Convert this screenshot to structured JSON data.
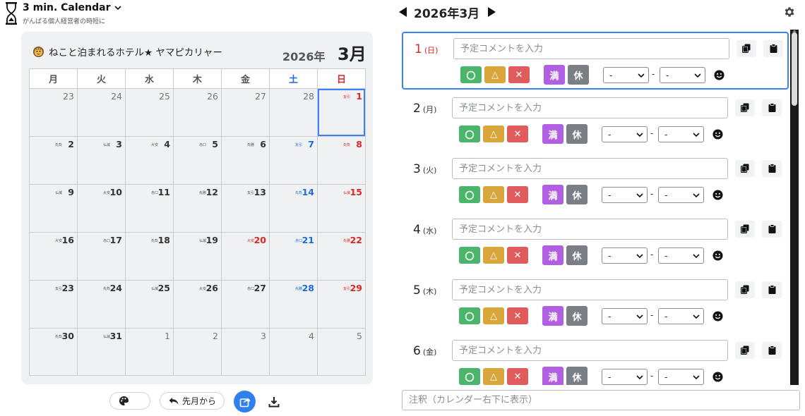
{
  "app": {
    "title": "3 min. Calendar",
    "subtitle": "がんばる個人経営者の時短に"
  },
  "calendar": {
    "hotel_name": "ねこと泊まれるホテル★ ヤマピカリャー",
    "year_label": "2026年",
    "month_label": "3月",
    "weekdays": [
      "月",
      "火",
      "水",
      "木",
      "金",
      "土",
      "日"
    ],
    "weeks": [
      [
        {
          "d": "23",
          "rk": "",
          "out": true
        },
        {
          "d": "24",
          "rk": "",
          "out": true
        },
        {
          "d": "25",
          "rk": "",
          "out": true
        },
        {
          "d": "26",
          "rk": "",
          "out": true
        },
        {
          "d": "27",
          "rk": "",
          "out": true
        },
        {
          "d": "28",
          "rk": "",
          "out": true
        },
        {
          "d": "1",
          "rk": "友引",
          "out": false,
          "selected": true
        }
      ],
      [
        {
          "d": "2",
          "rk": "先負"
        },
        {
          "d": "3",
          "rk": "仏滅"
        },
        {
          "d": "4",
          "rk": "大安"
        },
        {
          "d": "5",
          "rk": "赤口"
        },
        {
          "d": "6",
          "rk": "先勝"
        },
        {
          "d": "7",
          "rk": "友引"
        },
        {
          "d": "8",
          "rk": "先負"
        }
      ],
      [
        {
          "d": "9",
          "rk": "仏滅"
        },
        {
          "d": "10",
          "rk": "大安"
        },
        {
          "d": "11",
          "rk": "赤口"
        },
        {
          "d": "12",
          "rk": "先勝"
        },
        {
          "d": "13",
          "rk": "友引"
        },
        {
          "d": "14",
          "rk": "先負"
        },
        {
          "d": "15",
          "rk": "仏滅"
        }
      ],
      [
        {
          "d": "16",
          "rk": "大安"
        },
        {
          "d": "17",
          "rk": "赤口"
        },
        {
          "d": "18",
          "rk": "先負"
        },
        {
          "d": "19",
          "rk": "仏滅"
        },
        {
          "d": "20",
          "rk": "大安",
          "holiday": true
        },
        {
          "d": "21",
          "rk": "赤口"
        },
        {
          "d": "22",
          "rk": "先勝"
        }
      ],
      [
        {
          "d": "23",
          "rk": "友引"
        },
        {
          "d": "24",
          "rk": "先負"
        },
        {
          "d": "25",
          "rk": "仏滅"
        },
        {
          "d": "26",
          "rk": "大安"
        },
        {
          "d": "27",
          "rk": "赤口"
        },
        {
          "d": "28",
          "rk": "先勝"
        },
        {
          "d": "29",
          "rk": "友引"
        }
      ],
      [
        {
          "d": "30",
          "rk": "先負"
        },
        {
          "d": "31",
          "rk": "仏滅"
        },
        {
          "d": "1",
          "rk": "",
          "out": true
        },
        {
          "d": "2",
          "rk": "",
          "out": true
        },
        {
          "d": "3",
          "rk": "",
          "out": true
        },
        {
          "d": "4",
          "rk": "",
          "out": true
        },
        {
          "d": "5",
          "rk": "",
          "out": true
        }
      ]
    ]
  },
  "toolbar": {
    "prev_month_label": "先月から"
  },
  "editor": {
    "month_title": "2026年3月",
    "comment_placeholder": "予定コメントを入力",
    "status_ok": "〇",
    "status_few": "△",
    "status_ng": "✕",
    "status_full": "満",
    "status_rest": "休",
    "time_default": "-",
    "time_sep": "-",
    "days": [
      {
        "num": "1",
        "wd": "(日)",
        "sun": true,
        "selected": true
      },
      {
        "num": "2",
        "wd": "(月)"
      },
      {
        "num": "3",
        "wd": "(火)"
      },
      {
        "num": "4",
        "wd": "(水)"
      },
      {
        "num": "5",
        "wd": "(木)"
      },
      {
        "num": "6",
        "wd": "(金)"
      }
    ],
    "note_placeholder": "注釈（カレンダー右下に表示）"
  },
  "colors": {
    "accent": "#3b82f6",
    "saturday": "#1e6bd6",
    "sunday": "#d62828",
    "ok": "#4ab56b",
    "few": "#d9a63b",
    "ng": "#e05b5b",
    "full": "#b060e0",
    "rest": "#7a7f85"
  }
}
